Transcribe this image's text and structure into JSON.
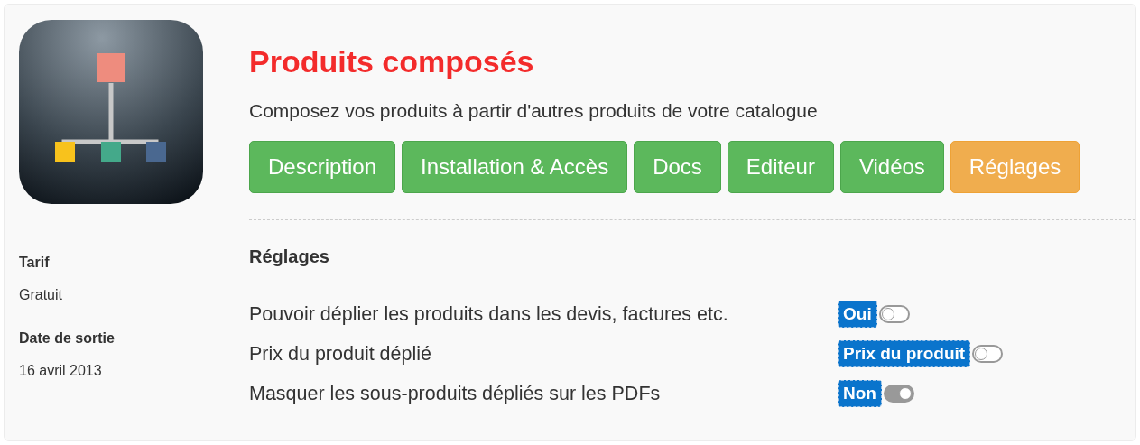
{
  "app": {
    "title": "Produits composés",
    "description": "Composez vos produits à partir d'autres produits de votre catalogue"
  },
  "tabs": [
    {
      "label": "Description",
      "selected": false
    },
    {
      "label": "Installation & Accès",
      "selected": false
    },
    {
      "label": "Docs",
      "selected": false
    },
    {
      "label": "Editeur",
      "selected": false
    },
    {
      "label": "Vidéos",
      "selected": false
    },
    {
      "label": "Réglages",
      "selected": true
    }
  ],
  "info": [
    {
      "label": "Tarif",
      "value": "Gratuit"
    },
    {
      "label": "Date de sortie",
      "value": "16 avril 2013"
    }
  ],
  "settings": {
    "heading": "Réglages",
    "rows": [
      {
        "label": "Pouvoir déplier les produits dans les devis, factures etc.",
        "value": "Oui",
        "on": false
      },
      {
        "label": "Prix du produit déplié",
        "value": "Prix du produit",
        "on": false
      },
      {
        "label": "Masquer les sous-produits dépliés sur les PDFs",
        "value": "Non",
        "on": true
      }
    ]
  }
}
